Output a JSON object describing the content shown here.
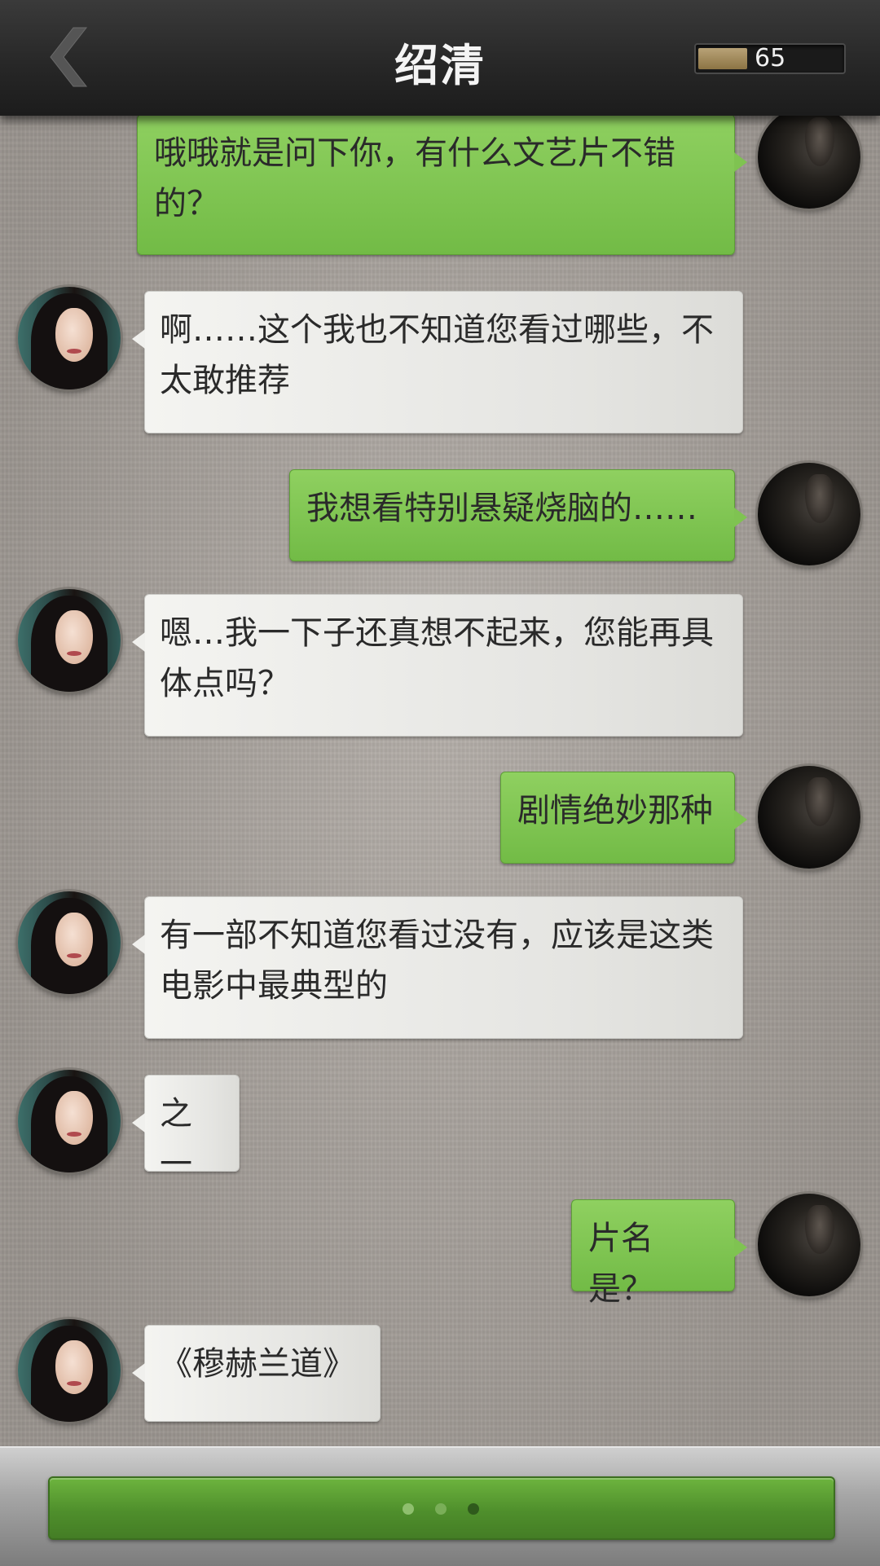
{
  "header": {
    "title": "绍清",
    "energy_value": "65",
    "energy_fill_fraction": 0.34,
    "back_icon": "chevron-left-icon"
  },
  "messages": [
    {
      "sender": "user",
      "text": "哦哦就是问下你，有什么文艺片不错的？"
    },
    {
      "sender": "npc",
      "text": "啊……这个我也不知道您看过哪些，不太敢推荐"
    },
    {
      "sender": "user",
      "text": "我想看特别悬疑烧脑的……"
    },
    {
      "sender": "npc",
      "text": "嗯…我一下子还真想不起来，您能再具体点吗？"
    },
    {
      "sender": "user",
      "text": "剧情绝妙那种"
    },
    {
      "sender": "npc",
      "text": "有一部不知道您看过没有，应该是这类电影中最典型的"
    },
    {
      "sender": "npc",
      "text": "之一"
    },
    {
      "sender": "user",
      "text": "片名是？"
    },
    {
      "sender": "npc",
      "text": "《穆赫兰道》"
    }
  ],
  "footer": {
    "typing_indicator": "typing-dots-icon"
  },
  "colors": {
    "user_bubble": "#7fc351",
    "npc_bubble": "#ececea",
    "header_bg": "#2a2a2a",
    "choice_button": "#5a9c33",
    "energy_fill": "#a68f5e"
  }
}
